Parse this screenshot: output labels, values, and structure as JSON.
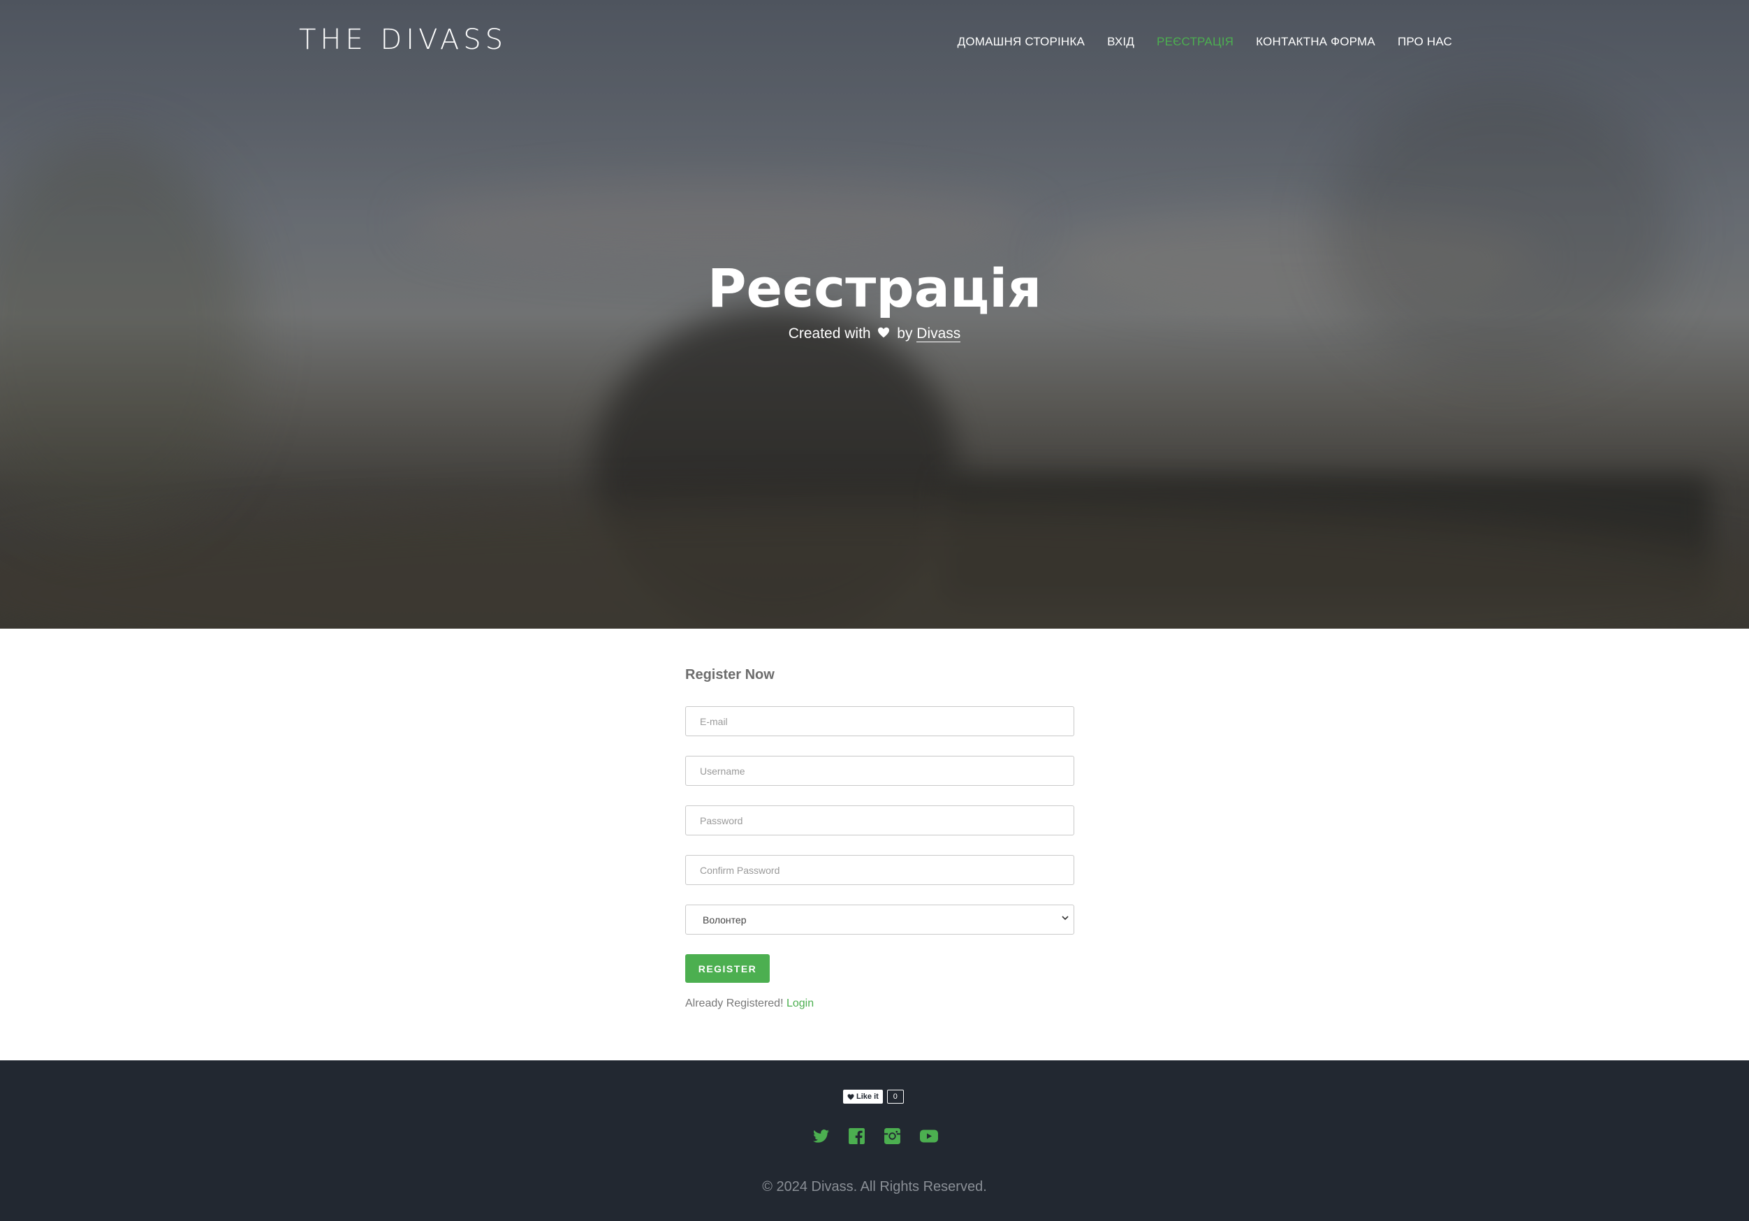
{
  "header": {
    "logo": "THE DIVASS",
    "nav": [
      {
        "label": "ДОМАШНЯ СТОРІНКА",
        "active": false
      },
      {
        "label": "ВХІД",
        "active": false
      },
      {
        "label": "РЕЄСТРАЦІЯ",
        "active": true
      },
      {
        "label": "КОНТАКТНА ФОРМА",
        "active": false
      },
      {
        "label": "ПРО НАС",
        "active": false
      }
    ]
  },
  "hero": {
    "title": "Реєстрація",
    "sub_prefix": "Created with",
    "sub_by": "by",
    "sub_credit": "Divass"
  },
  "form": {
    "title": "Register Now",
    "email_placeholder": "E-mail",
    "username_placeholder": "Username",
    "password_placeholder": "Password",
    "confirm_placeholder": "Confirm Password",
    "role_selected": "Волонтер",
    "register_label": "REGISTER",
    "already_text": "Already Registered!",
    "login_link": "Login"
  },
  "footer": {
    "like_label": "Like it",
    "like_count": "0",
    "social": [
      "twitter-icon",
      "facebook-icon",
      "instagram-icon",
      "youtube-icon"
    ],
    "copyright": "© 2024 Divass. All Rights Reserved."
  },
  "colors": {
    "accent": "#4caf50",
    "footer_bg": "#222831"
  }
}
